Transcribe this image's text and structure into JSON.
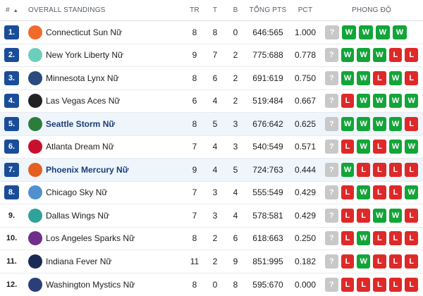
{
  "header": {
    "rank": "#",
    "team": "OVERALL STANDINGS",
    "tr": "TR",
    "t": "T",
    "b": "B",
    "pts": "TỔNG PTS",
    "pct": "PCT",
    "form": "PHONG ĐỘ",
    "sort_arrow": "▲"
  },
  "rows": [
    {
      "rank": "1.",
      "team": "Connecticut Sun Nữ",
      "logo": "connecticut-sun-logo",
      "logo_color": "#f06a2c",
      "tr": "8",
      "t": "8",
      "b": "0",
      "pts": "646:565",
      "pct": "1.000",
      "form": [
        "?",
        "W",
        "W",
        "W",
        "W"
      ]
    },
    {
      "rank": "2.",
      "team": "New York Liberty Nữ",
      "logo": "new-york-liberty-logo",
      "logo_color": "#6ecebc",
      "tr": "9",
      "t": "7",
      "b": "2",
      "pts": "775:688",
      "pct": "0.778",
      "form": [
        "?",
        "W",
        "W",
        "W",
        "L",
        "L"
      ]
    },
    {
      "rank": "3.",
      "team": "Minnesota Lynx Nữ",
      "logo": "minnesota-lynx-logo",
      "logo_color": "#2b4a7d",
      "tr": "8",
      "t": "6",
      "b": "2",
      "pts": "691:619",
      "pct": "0.750",
      "form": [
        "?",
        "W",
        "W",
        "L",
        "W",
        "L"
      ]
    },
    {
      "rank": "4.",
      "team": "Las Vegas Aces Nữ",
      "logo": "las-vegas-aces-logo",
      "logo_color": "#222222",
      "tr": "6",
      "t": "4",
      "b": "2",
      "pts": "519:484",
      "pct": "0.667",
      "form": [
        "?",
        "L",
        "W",
        "W",
        "W",
        "W"
      ]
    },
    {
      "rank": "5.",
      "team": "Seattle Storm Nữ",
      "logo": "seattle-storm-logo",
      "logo_color": "#2c7d3c",
      "tr": "8",
      "t": "5",
      "b": "3",
      "pts": "676:642",
      "pct": "0.625",
      "highlight": true,
      "form": [
        "?",
        "W",
        "W",
        "W",
        "W",
        "L"
      ]
    },
    {
      "rank": "6.",
      "team": "Atlanta Dream Nữ",
      "logo": "atlanta-dream-logo",
      "logo_color": "#c8102e",
      "tr": "7",
      "t": "4",
      "b": "3",
      "pts": "540:549",
      "pct": "0.571",
      "form": [
        "?",
        "L",
        "W",
        "L",
        "W",
        "W"
      ]
    },
    {
      "rank": "7.",
      "team": "Phoenix Mercury Nữ",
      "logo": "phoenix-mercury-logo",
      "logo_color": "#e56020",
      "tr": "9",
      "t": "4",
      "b": "5",
      "pts": "724:763",
      "pct": "0.444",
      "highlight": true,
      "form": [
        "?",
        "W",
        "L",
        "L",
        "L",
        "L"
      ]
    },
    {
      "rank": "8.",
      "team": "Chicago Sky Nữ",
      "logo": "chicago-sky-logo",
      "logo_color": "#5091cd",
      "tr": "7",
      "t": "3",
      "b": "4",
      "pts": "555:549",
      "pct": "0.429",
      "form": [
        "?",
        "L",
        "W",
        "L",
        "L",
        "W"
      ]
    },
    {
      "rank": "9.",
      "team": "Dallas Wings Nữ",
      "logo": "dallas-wings-logo",
      "logo_color": "#2fa39a",
      "tr": "7",
      "t": "3",
      "b": "4",
      "pts": "578:581",
      "pct": "0.429",
      "form": [
        "?",
        "L",
        "L",
        "W",
        "W",
        "L"
      ]
    },
    {
      "rank": "10.",
      "team": "Los Angeles Sparks Nữ",
      "logo": "los-angeles-sparks-logo",
      "logo_color": "#702f8a",
      "tr": "8",
      "t": "2",
      "b": "6",
      "pts": "618:663",
      "pct": "0.250",
      "form": [
        "?",
        "L",
        "W",
        "L",
        "L",
        "L"
      ]
    },
    {
      "rank": "11.",
      "team": "Indiana Fever Nữ",
      "logo": "indiana-fever-logo",
      "logo_color": "#1b2a55",
      "tr": "11",
      "t": "2",
      "b": "9",
      "pts": "851:995",
      "pct": "0.182",
      "form": [
        "?",
        "L",
        "W",
        "L",
        "L",
        "L"
      ]
    },
    {
      "rank": "12.",
      "team": "Washington Mystics Nữ",
      "logo": "washington-mystics-logo",
      "logo_color": "#2c3e7a",
      "tr": "8",
      "t": "0",
      "b": "8",
      "pts": "595:670",
      "pct": "0.000",
      "form": [
        "?",
        "L",
        "L",
        "L",
        "L",
        "L"
      ]
    }
  ],
  "colors": {
    "win": "#12a538",
    "loss": "#de2929",
    "upcoming": "#c8c8c8",
    "rank_badge": "#1a4d99",
    "highlight_row": "#eef5fb"
  }
}
